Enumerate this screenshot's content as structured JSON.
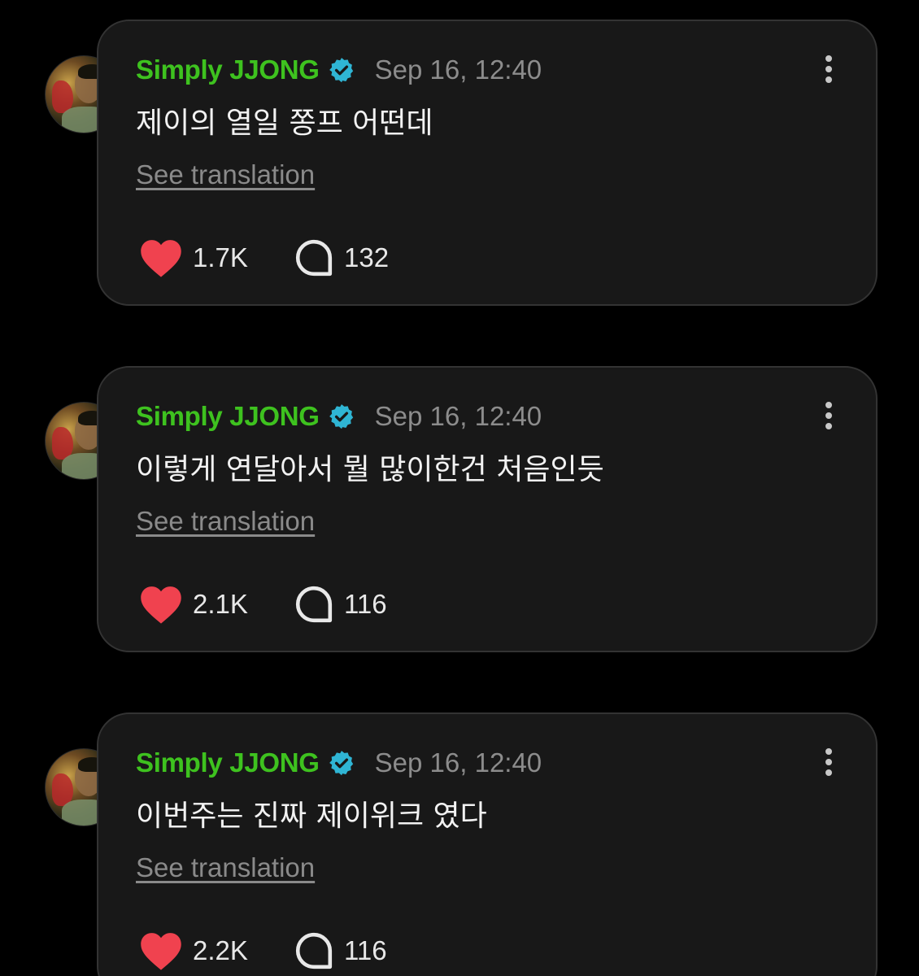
{
  "colors": {
    "background": "#000000",
    "card": "#181818",
    "author": "#3ec21f",
    "verified": "#2fb5d4",
    "like_heart": "#f0424f"
  },
  "posts": [
    {
      "author": "Simply JJONG",
      "timestamp": "Sep 16, 12:40",
      "text": "제이의 열일 쫑프 어떤데",
      "translate_label": "See translation",
      "likes": "1.7K",
      "comments": "132"
    },
    {
      "author": "Simply JJONG",
      "timestamp": "Sep 16, 12:40",
      "text": "이렇게 연달아서 뭘 많이한건 처음인듯",
      "translate_label": "See translation",
      "likes": "2.1K",
      "comments": "116"
    },
    {
      "author": "Simply JJONG",
      "timestamp": "Sep 16, 12:40",
      "text": "이번주는 진짜 제이위크 였다",
      "translate_label": "See translation",
      "likes": "2.2K",
      "comments": "116"
    }
  ],
  "icons": {
    "verified": "verified-badge-icon",
    "more": "more-vertical-icon",
    "like": "heart-icon",
    "comment": "comment-bubble-icon"
  }
}
